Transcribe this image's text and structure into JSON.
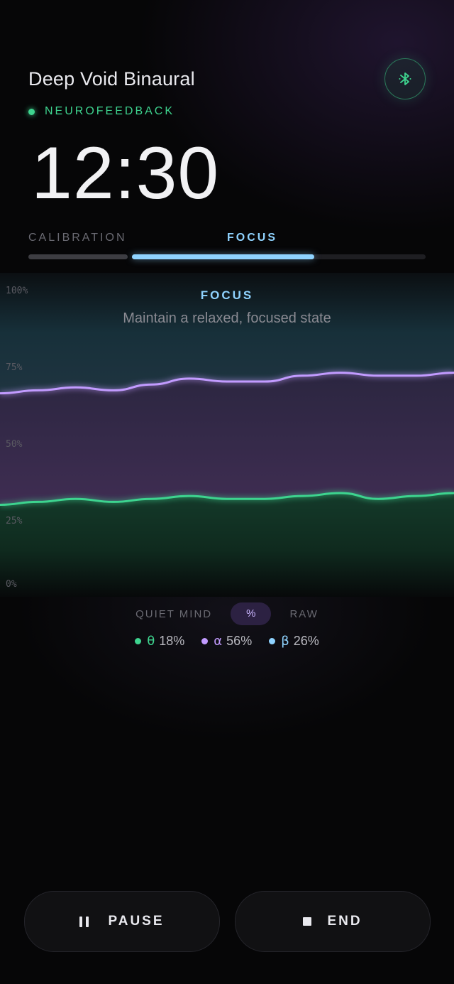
{
  "session": {
    "title": "Deep Void Binaural",
    "mode": "NEUROFEEDBACK",
    "timer": "12:30"
  },
  "phases": {
    "calibration_label": "CALIBRATION",
    "focus_label": "FOCUS",
    "focus_progress": 0.62
  },
  "chart": {
    "heading": "FOCUS",
    "subtitle": "Maintain a relaxed, focused state"
  },
  "view_toggle": {
    "options": [
      "QUIET MIND",
      "%",
      "RAW"
    ],
    "selected": "%"
  },
  "bands": [
    {
      "symbol": "θ",
      "value": "18%",
      "color": "#3ed48f"
    },
    {
      "symbol": "α",
      "value": "56%",
      "color": "#c29bff"
    },
    {
      "symbol": "β",
      "value": "26%",
      "color": "#8fd3ff"
    }
  ],
  "controls": {
    "pause_label": "PAUSE",
    "end_label": "END"
  },
  "colors": {
    "accent_green": "#3ed48f",
    "accent_blue": "#8fd3ff",
    "accent_purple": "#c29bff"
  },
  "chart_data": {
    "type": "area",
    "title": "FOCUS",
    "subtitle": "Maintain a relaxed, focused state",
    "y_ticks": [
      "100%",
      "75%",
      "50%",
      "25%",
      "0%"
    ],
    "ylim": [
      0,
      100
    ],
    "x": [
      0,
      1,
      2,
      3,
      4,
      5,
      6,
      7,
      8,
      9,
      10,
      11,
      12
    ],
    "series": [
      {
        "name": "θ",
        "color": "#3ed48f",
        "values": [
          27,
          28,
          29,
          28,
          29,
          30,
          29,
          29,
          30,
          31,
          29,
          30,
          31
        ]
      },
      {
        "name": "α",
        "color": "#c29bff",
        "values": [
          65,
          66,
          67,
          66,
          68,
          70,
          69,
          69,
          71,
          72,
          71,
          71,
          72
        ]
      }
    ]
  }
}
